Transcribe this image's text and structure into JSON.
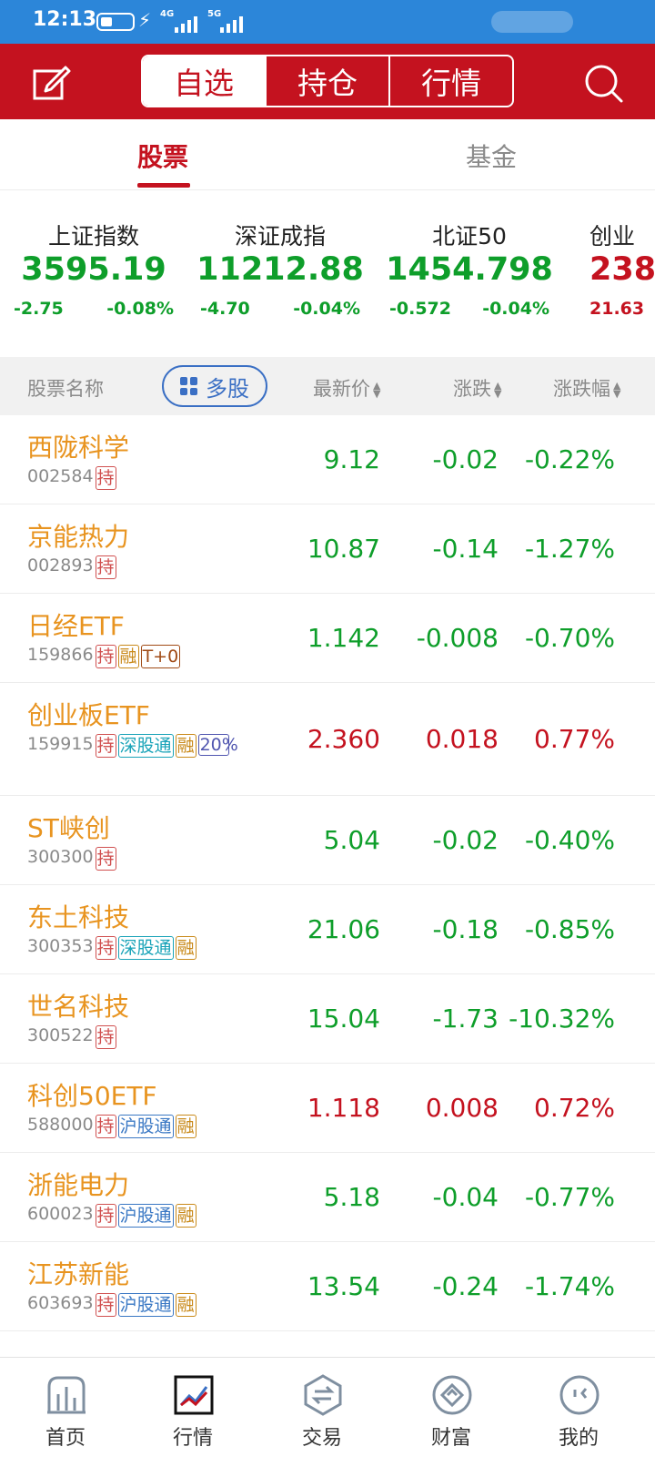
{
  "status_bar": {
    "time": "12:13",
    "net1": "4G",
    "net2": "5G"
  },
  "header": {
    "tabs": [
      {
        "label": "自选"
      },
      {
        "label": "持仓"
      },
      {
        "label": "行情"
      }
    ]
  },
  "sub_tabs": [
    {
      "label": "股票"
    },
    {
      "label": "基金"
    }
  ],
  "indices": [
    {
      "name": "上证指数",
      "value": "3595.19",
      "change": "-2.75",
      "percent": "-0.08%"
    },
    {
      "name": "深证成指",
      "value": "11212.88",
      "change": "-4.70",
      "percent": "-0.04%"
    },
    {
      "name": "北证50",
      "value": "1454.798",
      "change": "-0.572",
      "percent": "-0.04%"
    },
    {
      "name": "创业",
      "value": "238",
      "change": "21.63",
      "percent": ""
    }
  ],
  "columns": {
    "name": "股票名称",
    "multi_button": "多股",
    "price": "最新价",
    "change": "涨跌",
    "percent": "涨跌幅"
  },
  "stocks": [
    {
      "name": "西陇科学",
      "code": "002584",
      "price": "9.12",
      "change": "-0.02",
      "percent": "-0.22%",
      "tags": [
        "持"
      ]
    },
    {
      "name": "京能热力",
      "code": "002893",
      "price": "10.87",
      "change": "-0.14",
      "percent": "-1.27%",
      "tags": [
        "持"
      ]
    },
    {
      "name": "日经ETF",
      "code": "159866",
      "price": "1.142",
      "change": "-0.008",
      "percent": "-0.70%",
      "tags": [
        "持",
        "融",
        "T+0"
      ]
    },
    {
      "name": "创业板ETF",
      "code": "159915",
      "price": "2.360",
      "change": "0.018",
      "percent": "0.77%",
      "tags": [
        "持",
        "深股通",
        "融",
        "20%"
      ]
    },
    {
      "name": "ST峡创",
      "code": "300300",
      "price": "5.04",
      "change": "-0.02",
      "percent": "-0.40%",
      "tags": [
        "持"
      ]
    },
    {
      "name": "东土科技",
      "code": "300353",
      "price": "21.06",
      "change": "-0.18",
      "percent": "-0.85%",
      "tags": [
        "持",
        "深股通",
        "融"
      ]
    },
    {
      "name": "世名科技",
      "code": "300522",
      "price": "15.04",
      "change": "-1.73",
      "percent": "-10.32%",
      "tags": [
        "持"
      ]
    },
    {
      "name": "科创50ETF",
      "code": "588000",
      "price": "1.118",
      "change": "0.008",
      "percent": "0.72%",
      "tags": [
        "持",
        "沪股通",
        "融"
      ]
    },
    {
      "name": "浙能电力",
      "code": "600023",
      "price": "5.18",
      "change": "-0.04",
      "percent": "-0.77%",
      "tags": [
        "持",
        "沪股通",
        "融"
      ]
    },
    {
      "name": "江苏新能",
      "code": "603693",
      "price": "13.54",
      "change": "-0.24",
      "percent": "-1.74%",
      "tags": [
        "持",
        "沪股通",
        "融"
      ]
    }
  ],
  "bottom_nav": [
    {
      "label": "首页",
      "icon": "chart-bar-icon"
    },
    {
      "label": "行情",
      "icon": "trend-line-icon"
    },
    {
      "label": "交易",
      "icon": "exchange-icon"
    },
    {
      "label": "财富",
      "icon": "diamond-icon"
    },
    {
      "label": "我的",
      "icon": "profile-icon"
    }
  ],
  "colors": {
    "brand_red": "#c4121f",
    "up_red": "#c4121f",
    "down_green": "#0e9e2a",
    "stock_name": "#e89420",
    "status_bar": "#2c86d9"
  }
}
